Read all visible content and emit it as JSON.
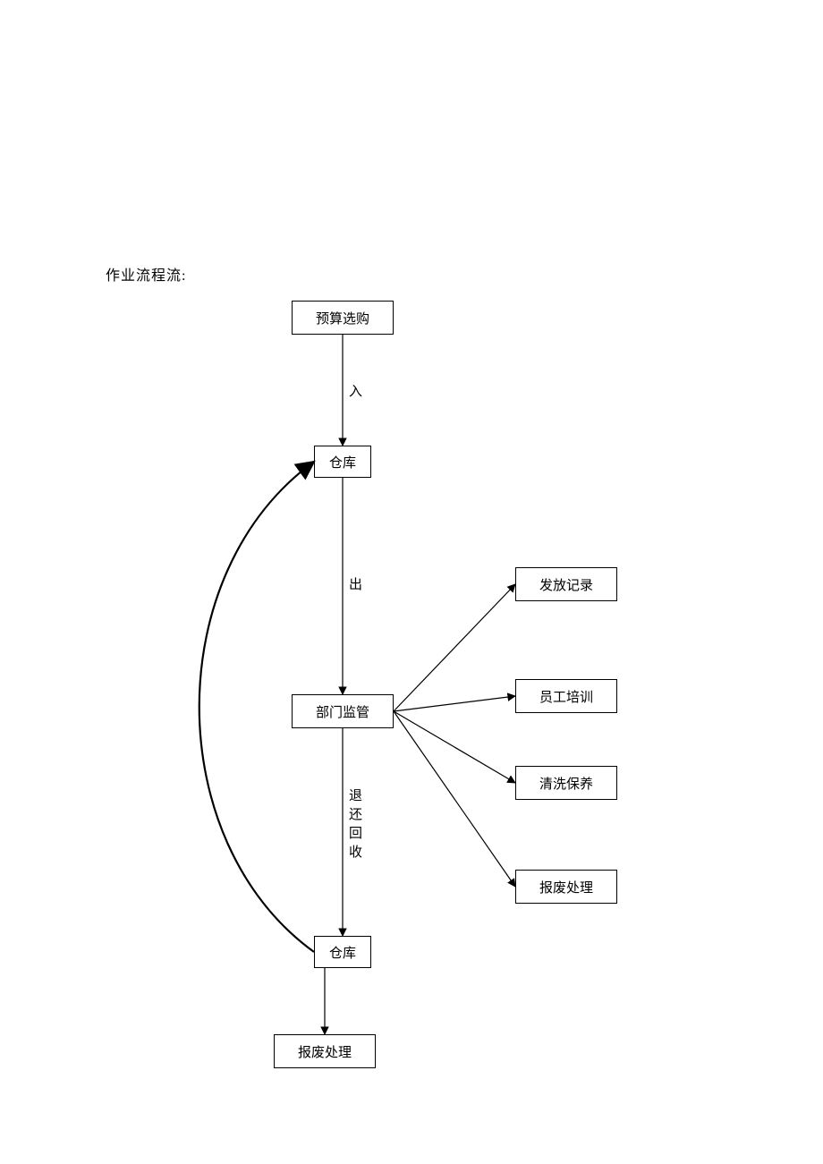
{
  "heading": "作业流程流:",
  "nodes": {
    "budget": "预算选购",
    "warehouse1": "仓库",
    "dept": "部门监管",
    "warehouse2": "仓库",
    "scrap_bottom": "报废处理",
    "issue_record": "发放记录",
    "staff_training": "员工培训",
    "clean_maint": "清洗保养",
    "scrap_right": "报废处理"
  },
  "edge_labels": {
    "in": "入",
    "out": "出",
    "return": "退\n还\n回\n收"
  }
}
